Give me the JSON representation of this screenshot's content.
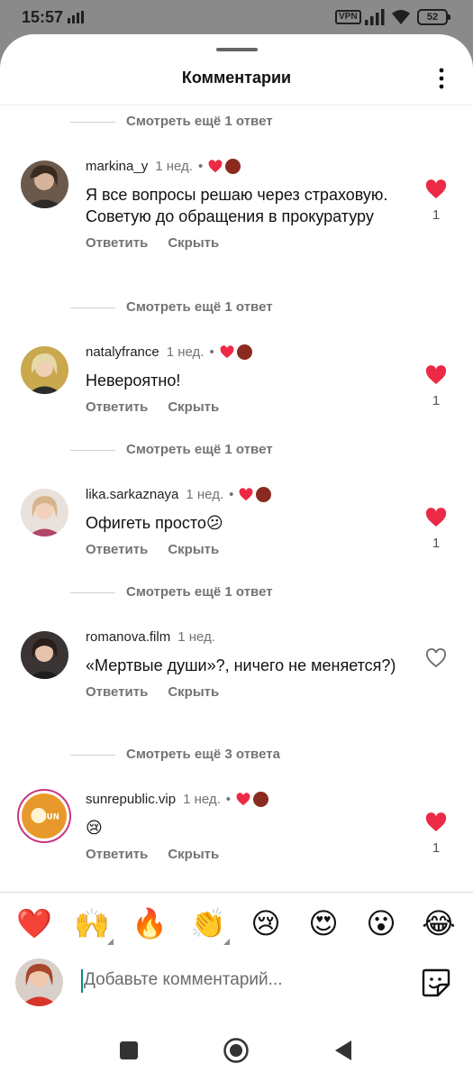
{
  "status_bar": {
    "time": "15:57",
    "vpn": "VPN",
    "battery": "52"
  },
  "header": {
    "title": "Комментарии"
  },
  "comments": [
    {
      "replies_label": "Смотреть ещё 1 ответ"
    },
    {
      "username": "markina_y",
      "time": "1 нед.",
      "text": "Я все вопросы решаю через страховую. Советую до обращения в прокуратуру",
      "reply": "Ответить",
      "hide": "Скрыть",
      "liked": true,
      "likes": "1",
      "replies_label": "Смотреть ещё 1 ответ"
    },
    {
      "username": "natalyfrance",
      "time": "1 нед.",
      "text": "Невероятно!",
      "reply": "Ответить",
      "hide": "Скрыть",
      "liked": true,
      "likes": "1",
      "replies_label": "Смотреть ещё 1 ответ"
    },
    {
      "username": "lika.sarkaznaya",
      "time": "1 нед.",
      "text": "Офигеть просто😕",
      "reply": "Ответить",
      "hide": "Скрыть",
      "liked": true,
      "likes": "1",
      "replies_label": "Смотреть ещё 1 ответ"
    },
    {
      "username": "romanova.film",
      "time": "1 нед.",
      "text": "«Мертвые души»?, ничего не меняется?)",
      "reply": "Ответить",
      "hide": "Скрыть",
      "liked": false,
      "likes": "",
      "replies_label": "Смотреть ещё 3 ответа"
    },
    {
      "username": "sunrepublic.vip",
      "time": "1 нед.",
      "text": "😢",
      "reply": "Ответить",
      "hide": "Скрыть",
      "liked": true,
      "likes": "1"
    }
  ],
  "emoji_bar": [
    "❤️",
    "🙌",
    "🔥",
    "👏",
    "😢",
    "😍",
    "😮",
    "😂"
  ],
  "composer": {
    "placeholder": "Добавьте комментарий..."
  },
  "colors": {
    "like_red": "#ed2a45",
    "muted_text": "#737373",
    "accent_cursor": "#0a8a8a"
  },
  "icons": [
    "more-vertical-icon",
    "heart-filled-icon",
    "heart-outline-icon",
    "sticker-icon",
    "nav-square-icon",
    "nav-home-icon",
    "nav-back-icon"
  ]
}
